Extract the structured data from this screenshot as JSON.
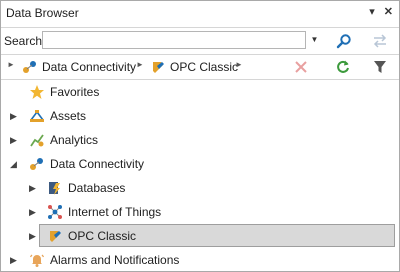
{
  "panel": {
    "title": "Data Browser",
    "pin_icon": "dropdown-arrow-icon",
    "close_icon": "close-icon"
  },
  "search": {
    "label": "Search:",
    "value": "",
    "placeholder": ""
  },
  "breadcrumb": {
    "items": [
      "Data Connectivity",
      "OPC Classic"
    ]
  },
  "tree": {
    "items": [
      {
        "label": "Favorites"
      },
      {
        "label": "Assets"
      },
      {
        "label": "Analytics"
      },
      {
        "label": "Data Connectivity"
      },
      {
        "label": "Databases"
      },
      {
        "label": "Internet of Things"
      },
      {
        "label": "OPC Classic"
      },
      {
        "label": "Alarms and Notifications"
      }
    ]
  },
  "colors": {
    "accent_blue": "#1f6fb5",
    "selection": "#d9d9d9",
    "refresh_green": "#3c9a3c"
  }
}
